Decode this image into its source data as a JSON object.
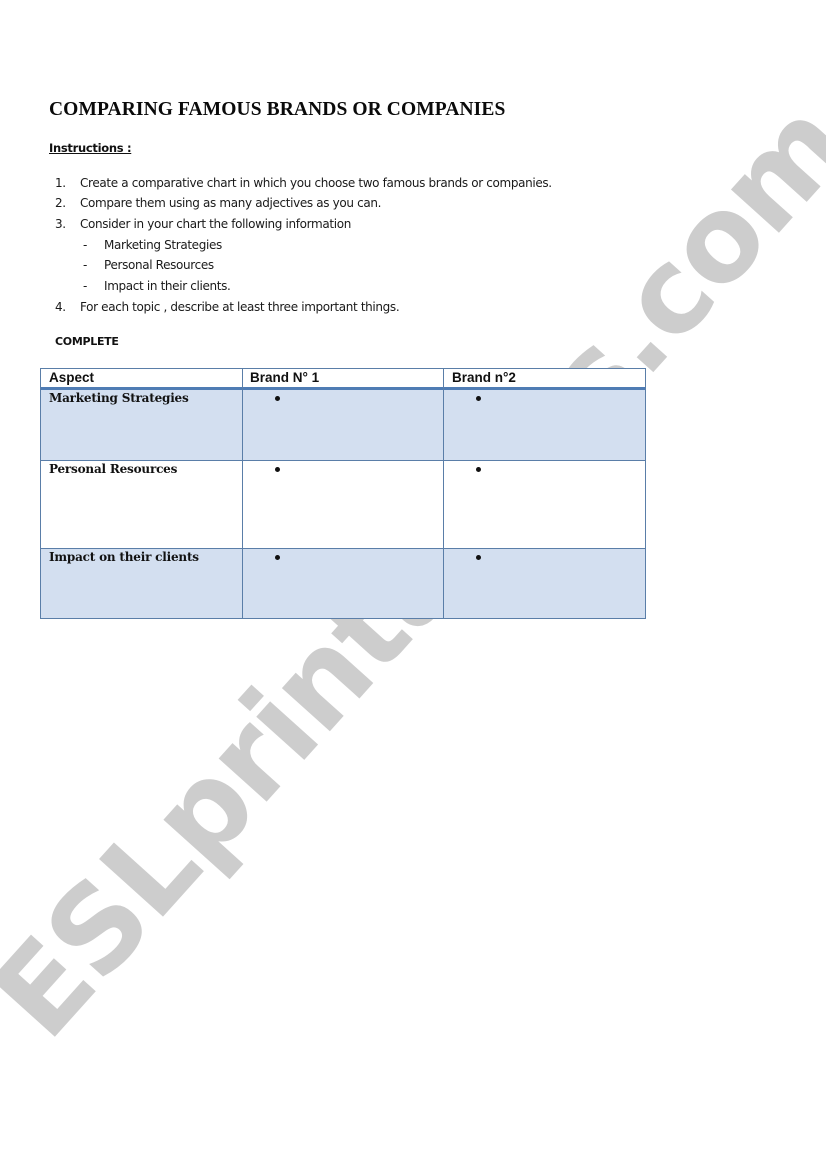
{
  "title": "COMPARING FAMOUS BRANDS OR COMPANIES",
  "instructions_label": "Instructions :",
  "instructions": [
    {
      "num": "1.",
      "text": "Create a comparative chart in which you choose two famous brands or companies."
    },
    {
      "num": "2.",
      "text": "Compare them using as many adjectives as you can."
    },
    {
      "num": "3.",
      "text": "Consider in your chart the following information"
    },
    {
      "num": "-",
      "text": "Marketing Strategies",
      "sub": true
    },
    {
      "num": "-",
      "text": "Personal Resources",
      "sub": true
    },
    {
      "num": "-",
      "text": "Impact in their clients.",
      "sub": true
    },
    {
      "num": "4.",
      "text": "For each topic , describe at least three important things."
    }
  ],
  "complete_label": "COMPLETE",
  "table": {
    "headers": [
      "Aspect",
      "Brand N° 1",
      "Brand n°2"
    ],
    "rows": [
      {
        "aspect": "Marketing Strategies",
        "brand1": "",
        "brand2": ""
      },
      {
        "aspect": "Personal Resources",
        "brand1": "",
        "brand2": ""
      },
      {
        "aspect": "Impact on their clients",
        "brand1": "",
        "brand2": ""
      }
    ],
    "colors": {
      "band": "#d3dff0",
      "border": "#5a7ea8",
      "header_rule": "#4f7cb4"
    }
  },
  "watermark": "ESLprintables.com"
}
